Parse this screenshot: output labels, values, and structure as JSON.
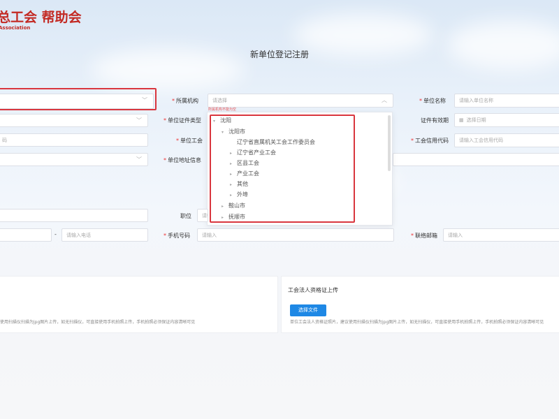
{
  "logo": {
    "cn": "总工会 帮助会",
    "en": "Association"
  },
  "page_title": "新单位登记注册",
  "labels": {
    "org": "所属机构",
    "unit_name": "单位名称",
    "cert_type": "单位证件类型",
    "cert_validity": "证件有效期",
    "union": "单位工会",
    "union_credit": "工会信用代码",
    "address": "单位地址信息",
    "position": "职位",
    "mobile": "手机号码",
    "email": "联络邮箱"
  },
  "placeholders": {
    "org": "请选择",
    "unit_name": "请输入单位名称",
    "cert_validity": "选择日期",
    "union_credit": "请输入工会信用代码",
    "left_code": "码",
    "phone": "请输入电话",
    "input": "请输入"
  },
  "error_text": "所属机构不能为空",
  "tree": [
    {
      "label": "沈阳",
      "caret": "▾"
    },
    {
      "label": "沈阳市",
      "caret": "▾"
    },
    {
      "label": "辽宁省直属机关工会工作委员会",
      "caret": ""
    },
    {
      "label": "辽宁省产业工会",
      "caret": "▸"
    },
    {
      "label": "区县工会",
      "caret": "▸"
    },
    {
      "label": "产业工会",
      "caret": "▸"
    },
    {
      "label": "其他",
      "caret": "▸"
    },
    {
      "label": "外埠",
      "caret": "▸"
    },
    {
      "label": "鞍山市",
      "caret": "▸"
    },
    {
      "label": "抚顺市",
      "caret": "▸"
    }
  ],
  "upload": {
    "title": "工会法人资格证上传",
    "button": "选择文件",
    "hint_right": "单位工会法人资格证照片，建议使用扫描仪扫描为jpg图片上传，如无扫描仪，可直接使用手机拍照上传，手机拍照必须保证内容清晰可见",
    "hint_left": "使用扫描仪扫描为jpg图片上传，如无扫描仪，可直接使用手机拍照上传，手机拍照必须保证内容清晰可见"
  },
  "colors": {
    "accent": "#1e88e5",
    "highlight": "#d9363e",
    "logo": "#c32a24"
  }
}
